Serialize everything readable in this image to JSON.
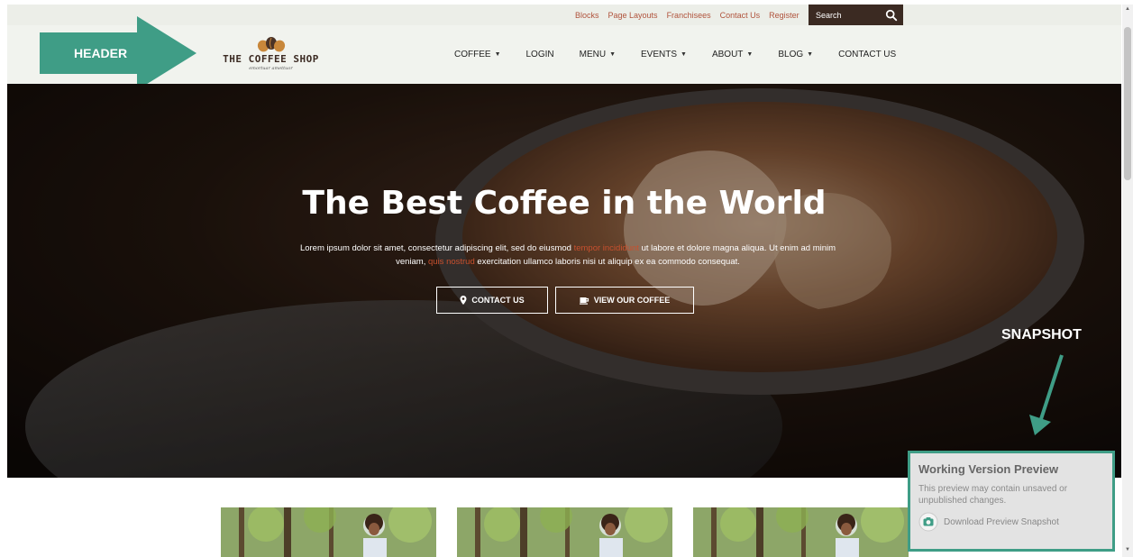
{
  "top_links": [
    "Blocks",
    "Page Layouts",
    "Franchisees",
    "Contact Us",
    "Register"
  ],
  "search": {
    "placeholder": "Search",
    "icon": "search-icon"
  },
  "logo": {
    "name": "THE COFFEE SHOP",
    "tagline": "emortuar amettuor"
  },
  "nav": {
    "items": [
      {
        "label": "COFFEE",
        "dropdown": true
      },
      {
        "label": "LOGIN",
        "dropdown": false
      },
      {
        "label": "MENU",
        "dropdown": true
      },
      {
        "label": "EVENTS",
        "dropdown": true
      },
      {
        "label": "ABOUT",
        "dropdown": true
      },
      {
        "label": "BLOG",
        "dropdown": true
      },
      {
        "label": "CONTACT US",
        "dropdown": false
      }
    ]
  },
  "annotations": {
    "header": "HEADER",
    "snapshot": "SNAPSHOT",
    "color": "#3f9d86"
  },
  "hero": {
    "title": "The Best Coffee in the World",
    "body_1": "Lorem ipsum dolor sit amet, consectetur adipiscing elit, sed do eiusmod ",
    "body_hl_1": "tempor incididunt",
    "body_2": " ut labore et dolore magna aliqua. Ut enim ad minim veniam, ",
    "body_hl_2": "quis nostrud",
    "body_3": " exercitation ullamco laboris nisi ut aliquip ex ea commodo consequat.",
    "buttons": {
      "contact": "CONTACT US",
      "coffee": "VIEW OUR COFFEE"
    },
    "accent_color": "#c8502e"
  },
  "snapshot_panel": {
    "title": "Working Version Preview",
    "description": "This preview may contain unsaved or unpublished changes.",
    "link": "Download Preview Snapshot"
  },
  "cards": [
    {
      "name": "card-image-1"
    },
    {
      "name": "card-image-2"
    },
    {
      "name": "card-image-3"
    }
  ]
}
